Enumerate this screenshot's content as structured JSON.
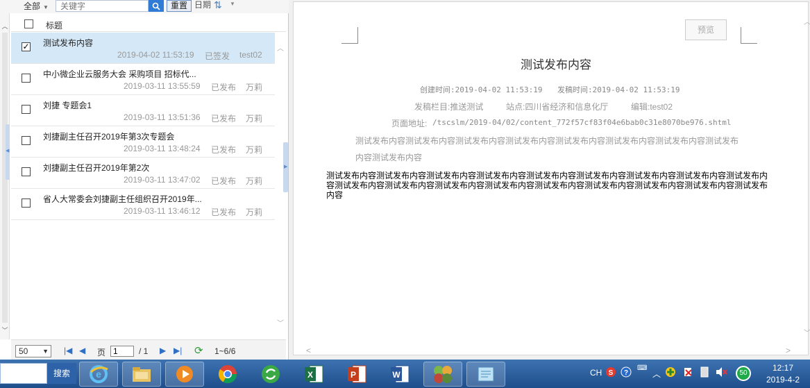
{
  "filter": {
    "scope": "全部",
    "search_placeholder": "关键字",
    "reset_label": "重置",
    "date_label": "日期"
  },
  "list": {
    "header_title": "标题",
    "rows": [
      {
        "title": "测试发布内容",
        "time": "2019-04-02 11:53:19",
        "status": "已签发",
        "editor": "test02",
        "checked": true
      },
      {
        "title": "中小微企业云服务大会 采购项目 招标代...",
        "time": "2019-03-11 13:55:59",
        "status": "已发布",
        "editor": "万莉",
        "checked": false
      },
      {
        "title": "刘捷 专题会1",
        "time": "2019-03-11 13:51:36",
        "status": "已发布",
        "editor": "万莉",
        "checked": false
      },
      {
        "title": "刘捷副主任召开2019年第3次专题会",
        "time": "2019-03-11 13:48:24",
        "status": "已发布",
        "editor": "万莉",
        "checked": false
      },
      {
        "title": "刘捷副主任召开2019年第2次",
        "time": "2019-03-11 13:47:02",
        "status": "已发布",
        "editor": "万莉",
        "checked": false
      },
      {
        "title": "省人大常委会刘捷副主任组织召开2019年...",
        "time": "2019-03-11 13:46:12",
        "status": "已发布",
        "editor": "万莉",
        "checked": false
      }
    ]
  },
  "pager": {
    "page_size": "50",
    "page_label": "页",
    "current_page": "1",
    "total_pages": "/ 1",
    "range": "1~6/6"
  },
  "preview": {
    "button_label": "预览",
    "title": "测试发布内容",
    "created": "创建时间:2019-04-02 11:53:19",
    "published": "发稿时间:2019-04-02 11:53:19",
    "column": "发稿栏目:推送测试",
    "site": "站点:四川省经济和信息化厅",
    "editor": "编辑:test02",
    "url_label": "页面地址:",
    "url": "/tscslm/2019-04/02/content_772f57cf83f04e6bab0c31e8070be976.shtml",
    "summary": "测试发布内容测试发布内容测试发布内容测试发布内容测试发布内容测试发布内容测试发布内容测试发布内容测试发布内容",
    "body": "测试发布内容测试发布内容测试发布内容测试发布内容测试发布内容测试发布内容测试发布内容测试发布内容测试发布内容测试发布内容测试发布内容测试发布内容测试发布内容测试发布内容测试发布内容测试发布内容测试发布内容测试发布内容"
  },
  "taskbar": {
    "search_label": "搜索",
    "lang": "CH",
    "battery": "50",
    "time": "12:17",
    "date": "2019-4-2"
  }
}
